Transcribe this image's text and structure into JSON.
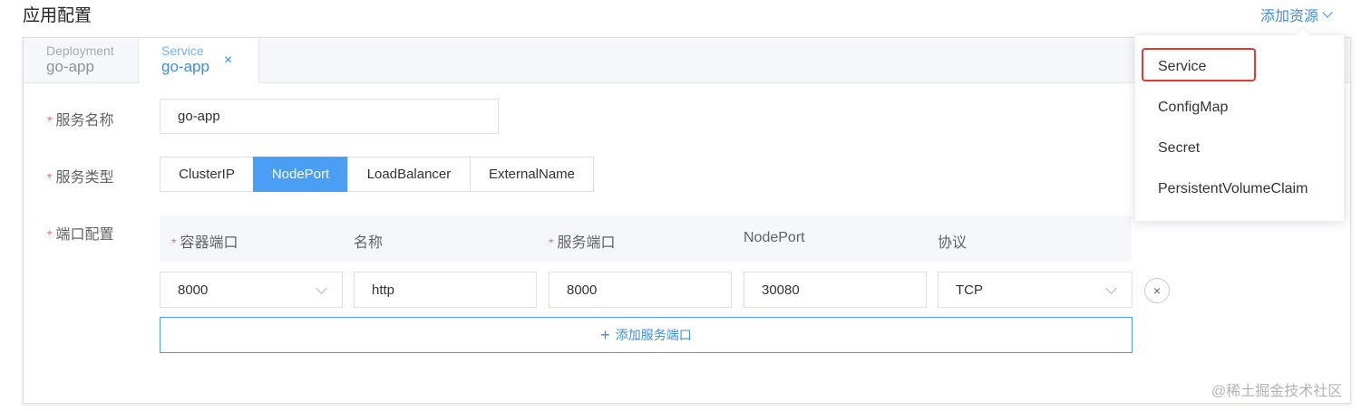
{
  "header": {
    "title": "应用配置",
    "add_resource_label": "添加资源"
  },
  "tabs": [
    {
      "kind": "Deployment",
      "name": "go-app",
      "active": false
    },
    {
      "kind": "Service",
      "name": "go-app",
      "active": true,
      "close": "×"
    }
  ],
  "form": {
    "service_name": {
      "required": "*",
      "label": "服务名称",
      "value": "go-app"
    },
    "service_type": {
      "required": "*",
      "label": "服务类型",
      "options": [
        "ClusterIP",
        "NodePort",
        "LoadBalancer",
        "ExternalName"
      ],
      "selected": "NodePort"
    },
    "ports": {
      "required": "*",
      "label": "端口配置",
      "headers": {
        "container_port": {
          "required": "*",
          "label": "容器端口"
        },
        "name": {
          "label": "名称"
        },
        "service_port": {
          "required": "*",
          "label": "服务端口"
        },
        "node_port": {
          "label": "NodePort"
        },
        "protocol": {
          "label": "协议"
        }
      },
      "rows": [
        {
          "container_port": "8000",
          "name": "http",
          "service_port": "8000",
          "node_port": "30080",
          "protocol": "TCP",
          "remove": "×"
        }
      ],
      "add_label": "添加服务端口",
      "add_icon": "+"
    }
  },
  "dropdown": {
    "items": [
      "Service",
      "ConfigMap",
      "Secret",
      "PersistentVolumeClaim"
    ],
    "highlighted": "Service",
    "highlight_color": "#e53935"
  },
  "watermark": "@稀土掘金技术社区",
  "colors": {
    "accent": "#3a8ee6",
    "selected_fill": "#4a9ff5",
    "required": "#f56c6c"
  }
}
